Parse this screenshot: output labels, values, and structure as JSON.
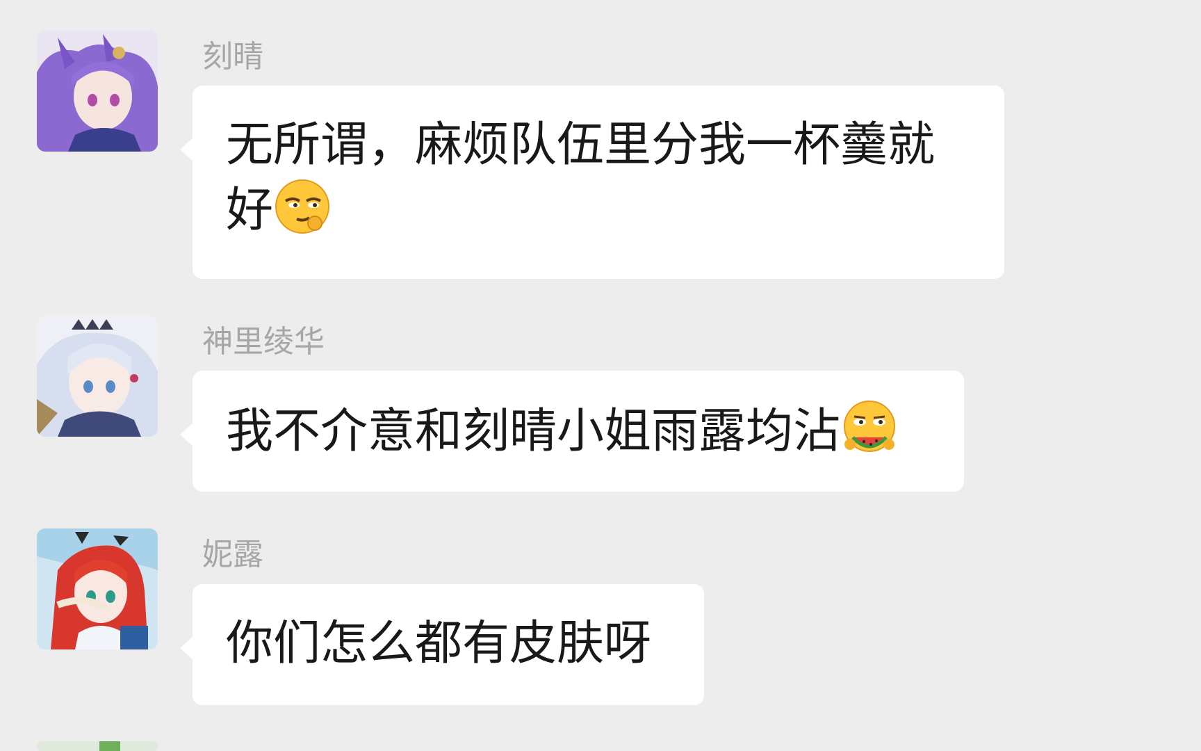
{
  "chat": {
    "messages": [
      {
        "sender": "刻晴",
        "text": "无所谓，麻烦队伍里分我一杯羹就好",
        "emoji": "smirk-emoji"
      },
      {
        "sender": "神里绫华",
        "text": "我不介意和刻晴小姐雨露均沾",
        "emoji": "eating-watermelon-emoji"
      },
      {
        "sender": "妮露",
        "text": "你们怎么都有皮肤呀"
      }
    ]
  },
  "colors": {
    "background": "#ededed",
    "bubble": "#ffffff",
    "sender_name": "#a6a6a6",
    "message_text": "#191919"
  }
}
